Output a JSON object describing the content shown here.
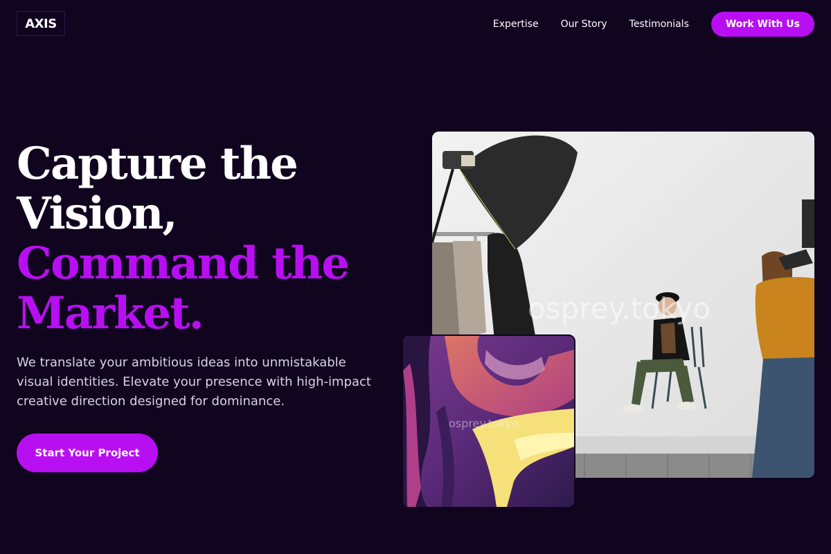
{
  "header": {
    "logo_text": "AXIS",
    "nav": [
      {
        "label": "Expertise"
      },
      {
        "label": "Our Story"
      },
      {
        "label": "Testimonials"
      }
    ],
    "cta_label": "Work With Us"
  },
  "hero": {
    "headline_line1": "Capture the",
    "headline_line2": "Vision,",
    "headline_line3": "Command the",
    "headline_line4": "Market.",
    "subtext": "We translate your ambitious ideas into unmistakable visual identities. Elevate your presence with high-impact creative direction designed for dominance.",
    "cta_label": "Start Your Project"
  },
  "images": {
    "studio_watermark": "osprey.tokyo",
    "abstract_watermark": "osprey.tokyo"
  },
  "colors": {
    "background": "#10041f",
    "accent": "#b80ff2",
    "text": "#ffffff",
    "subtext": "#d9d2e6"
  }
}
